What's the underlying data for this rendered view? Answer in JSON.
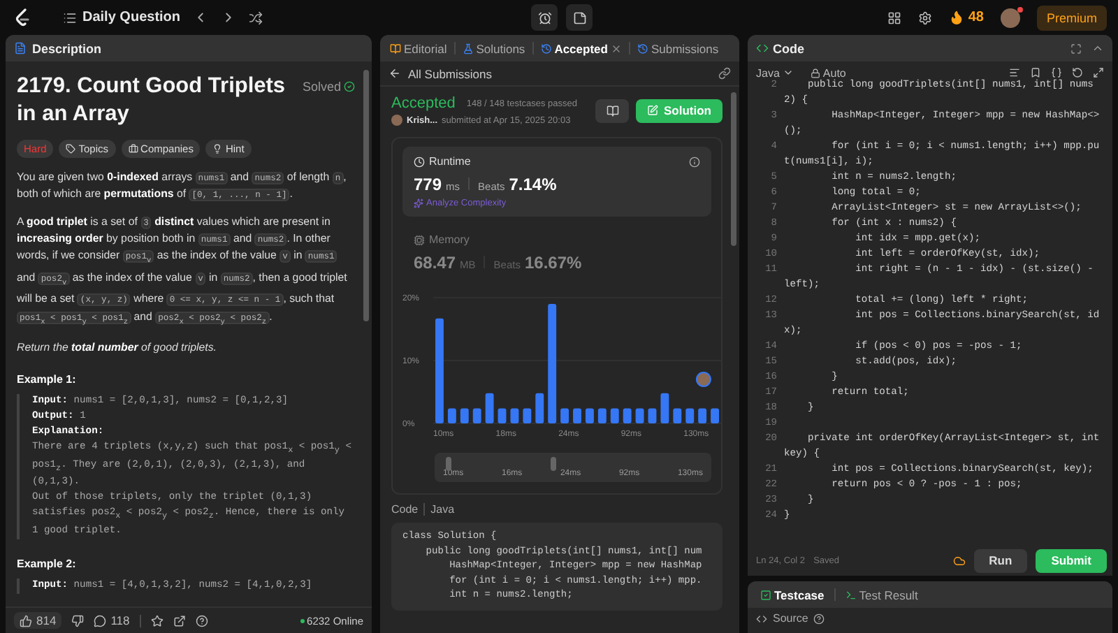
{
  "top_bar": {
    "title": "Daily Question",
    "streak": "48",
    "premium": "Premium"
  },
  "description": {
    "tab": "Description",
    "title": "2179. Count Good Triplets in an Array",
    "status": "Solved",
    "tags": [
      {
        "kind": "difficulty",
        "label": "Hard"
      },
      {
        "kind": "topics",
        "label": "Topics"
      },
      {
        "kind": "companies",
        "label": "Companies"
      },
      {
        "kind": "hint",
        "label": "Hint"
      }
    ],
    "paragraphs": [
      {
        "kind": "plain",
        "segments": [
          {
            "kind": "text",
            "text": "You are given two **0-indexed** arrays "
          },
          {
            "kind": "code",
            "text": "nums1"
          },
          {
            "kind": "text",
            "text": " and "
          },
          {
            "kind": "code",
            "text": "nums2"
          },
          {
            "kind": "text",
            "text": " of length "
          },
          {
            "kind": "code",
            "text": "n"
          },
          {
            "kind": "text",
            "text": ", both of which are **permutations** of "
          },
          {
            "kind": "code",
            "text": "[0, 1, ..., n - 1]"
          },
          {
            "kind": "text",
            "text": "."
          }
        ]
      },
      {
        "kind": "plain",
        "segments": [
          {
            "kind": "text",
            "text": "A **good triplet** is a set of "
          },
          {
            "kind": "code",
            "text": "3"
          },
          {
            "kind": "text",
            "text": " **distinct** values which are present in **increasing order** by position both in "
          },
          {
            "kind": "code",
            "text": "nums1"
          },
          {
            "kind": "text",
            "text": " and "
          },
          {
            "kind": "code",
            "text": "nums2"
          },
          {
            "kind": "text",
            "text": ". In other words, if we consider "
          },
          {
            "kind": "code",
            "text": "pos1$_{v}$"
          },
          {
            "kind": "text",
            "text": " as the index of the value "
          },
          {
            "kind": "code",
            "text": "v"
          },
          {
            "kind": "text",
            "text": " in "
          },
          {
            "kind": "code",
            "text": "nums1"
          },
          {
            "kind": "text",
            "text": " and "
          },
          {
            "kind": "code",
            "text": "pos2$_{v}$"
          },
          {
            "kind": "text",
            "text": " as the index of the value "
          },
          {
            "kind": "code",
            "text": "v"
          },
          {
            "kind": "text",
            "text": " in "
          },
          {
            "kind": "code",
            "text": "nums2"
          },
          {
            "kind": "text",
            "text": ", then a good triplet will be a set "
          },
          {
            "kind": "code",
            "text": "(x, y, z)"
          },
          {
            "kind": "text",
            "text": " where "
          },
          {
            "kind": "code",
            "text": "0 <= x, y, z <= n - 1"
          },
          {
            "kind": "text",
            "text": ", such that "
          },
          {
            "kind": "code",
            "text": "pos1$_{x}$ < pos1$_{y}$ < pos1$_{z}$"
          },
          {
            "kind": "text",
            "text": " and "
          },
          {
            "kind": "code",
            "text": "pos2$_{x}$ < pos2$_{y}$ < pos2$_{z}$"
          },
          {
            "kind": "text",
            "text": "."
          }
        ]
      },
      {
        "kind": "emphasis",
        "segments": [
          {
            "kind": "text",
            "text": "Return the **total number** of good triplets."
          }
        ]
      }
    ],
    "examples": [
      {
        "title": "Example 1:",
        "lines": [
          {
            "kind": "field",
            "label": "Input:",
            "text": "nums1 = [2,0,1,3], nums2 = [0,1,2,3]"
          },
          {
            "kind": "field",
            "label": "Output:",
            "text": "1"
          },
          {
            "kind": "field",
            "label": "Explanation:"
          },
          {
            "kind": "note",
            "text": "There are 4 triplets (x,y,z) such that pos1$_{x}$ < pos1$_{y}$ < pos1$_{z}$. They are (2,0,1), (2,0,3), (2,1,3), and (0,1,3)."
          },
          {
            "kind": "note",
            "text": "Out of those triplets, only the triplet (0,1,3) satisfies pos2$_{x}$ < pos2$_{y}$ < pos2$_{z}$. Hence, there is only 1 good triplet."
          }
        ]
      },
      {
        "title": "Example 2:",
        "lines": [
          {
            "kind": "field",
            "label": "Input:",
            "text": "nums1 = [4,0,1,3,2], nums2 = [4,1,0,2,3]"
          }
        ]
      }
    ],
    "footer": {
      "likes": "814",
      "comments": "118",
      "online": "6232 Online"
    }
  },
  "submission": {
    "tabs": [
      {
        "kind": "editorial",
        "label": "Editorial",
        "selected": false
      },
      {
        "kind": "solutions",
        "label": "Solutions",
        "selected": false
      },
      {
        "kind": "accepted",
        "label": "Accepted",
        "selected": true
      },
      {
        "kind": "submissions",
        "label": "Submissions",
        "selected": false
      }
    ],
    "back_link": "All Submissions",
    "status": "Accepted",
    "testcases": "148 / 148 testcases passed",
    "author": "Krish...",
    "submitted": "submitted at Apr 15, 2025 20:03",
    "solution_button": "Solution",
    "metrics": [
      {
        "kind": "runtime",
        "label": "Runtime",
        "value": "779",
        "unit": "ms",
        "beats_label": "Beats",
        "beats": "7.14%",
        "selected": true,
        "action": "Analyze Complexity"
      },
      {
        "kind": "memory",
        "label": "Memory",
        "value": "68.47",
        "unit": "MB",
        "beats_label": "Beats",
        "beats": "16.67%",
        "selected": false
      }
    ],
    "chart_data": {
      "type": "bar",
      "values": [
        16.7,
        2.4,
        2.4,
        2.4,
        4.8,
        2.4,
        2.4,
        2.4,
        4.8,
        19,
        2.4,
        2.4,
        2.4,
        2.4,
        2.4,
        2.4,
        2.4,
        2.4,
        4.8,
        2.4,
        2.4,
        2.4,
        2.4
      ],
      "categories": [
        "10ms",
        null,
        null,
        null,
        null,
        "18ms",
        null,
        null,
        null,
        null,
        "24ms",
        null,
        null,
        null,
        null,
        "92ms",
        null,
        null,
        null,
        null,
        "130ms",
        null,
        null
      ],
      "ylim": [
        0,
        20
      ],
      "yticks": [
        {
          "value": 0,
          "label": "0%"
        },
        {
          "value": 10,
          "label": "10%"
        },
        {
          "value": 20,
          "label": "20%"
        }
      ]
    },
    "range_labels": [
      "10ms",
      "16ms",
      "24ms",
      "92ms",
      "130ms"
    ],
    "code_label": "Code",
    "language": "Java",
    "code": [
      "class Solution {",
      "    public long goodTriplets(int[] nums1, int[] num",
      "        HashMap<Integer, Integer> mpp = new HashMap",
      "        for (int i = 0; i < nums1.length; i++) mpp.",
      "        int n = nums2.length;"
    ]
  },
  "editor": {
    "title": "Code",
    "language": "Java",
    "mode": "Auto",
    "lines": [
      {
        "number": "2",
        "text": "    public long goodTriplets(int[] nums1, int[] nums2) {"
      },
      {
        "number": "3",
        "text": "        HashMap<Integer, Integer> mpp = new HashMap<>();"
      },
      {
        "number": "4",
        "text": "        for (int i = 0; i < nums1.length; i++) mpp.put(nums1[i], i);"
      },
      {
        "number": "5",
        "text": "        int n = nums2.length;"
      },
      {
        "number": "6",
        "text": "        long total = 0;"
      },
      {
        "number": "7",
        "text": "        ArrayList<Integer> st = new ArrayList<>();"
      },
      {
        "number": "8",
        "text": "        for (int x : nums2) {"
      },
      {
        "number": "9",
        "text": "            int idx = mpp.get(x);"
      },
      {
        "number": "10",
        "text": "            int left = orderOfKey(st, idx);"
      },
      {
        "number": "11",
        "text": "            int right = (n - 1 - idx) - (st.size() - left);"
      },
      {
        "number": "12",
        "text": "            total += (long) left * right;"
      },
      {
        "number": "13",
        "text": "            int pos = Collections.binarySearch(st, idx);"
      },
      {
        "number": "14",
        "text": "            if (pos < 0) pos = -pos - 1;"
      },
      {
        "number": "15",
        "text": "            st.add(pos, idx);"
      },
      {
        "number": "16",
        "text": "        }"
      },
      {
        "number": "17",
        "text": "        return total;"
      },
      {
        "number": "18",
        "text": "    }"
      },
      {
        "number": "19"
      },
      {
        "number": "20",
        "text": "    private int orderOfKey(ArrayList<Integer> st, int key) {"
      },
      {
        "number": "21",
        "text": "        int pos = Collections.binarySearch(st, key);"
      },
      {
        "number": "22",
        "text": "        return pos < 0 ? -pos - 1 : pos;"
      },
      {
        "number": "23",
        "text": "    }"
      },
      {
        "number": "24",
        "text": "}"
      }
    ],
    "position": "Ln 24, Col 2",
    "save_state": "Saved",
    "run": "Run",
    "submit": "Submit"
  },
  "console": {
    "tabs": [
      {
        "kind": "testcase",
        "label": "Testcase",
        "selected": true
      },
      {
        "kind": "result",
        "label": "Test Result",
        "selected": false
      }
    ],
    "source": "Source"
  }
}
